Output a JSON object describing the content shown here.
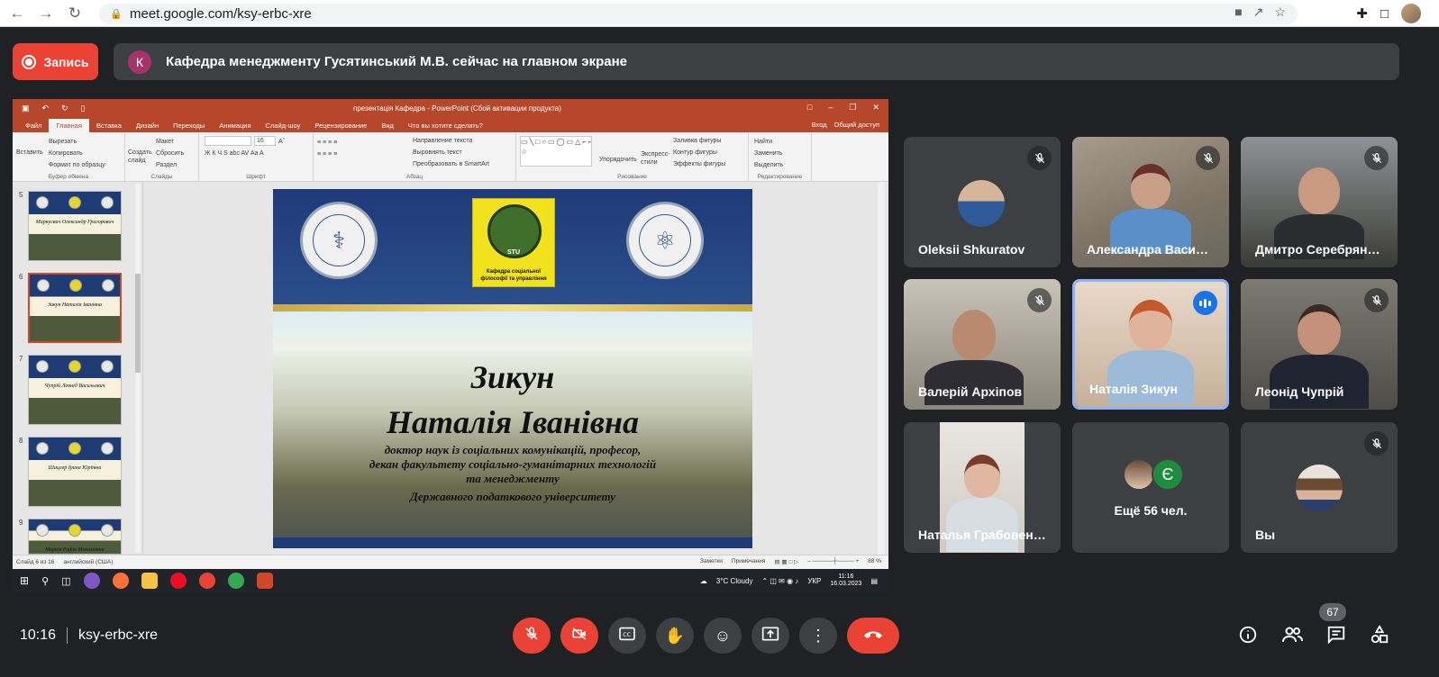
{
  "browser": {
    "url": "meet.google.com/ksy-erbc-xre"
  },
  "meet": {
    "record_label": "Запись",
    "presenter_initial": "К",
    "presenting_text": "Кафедра менеджменту Гусятинський М.В. сейчас на главном экране",
    "time": "10:16",
    "meeting_code": "ksy-erbc-xre",
    "participant_count": "67"
  },
  "powerpoint": {
    "doc_title": "презентація Кафедра - PowerPoint (Сбой активации продукта)",
    "tabs": [
      "Файл",
      "Главная",
      "Вставка",
      "Дизайн",
      "Переходы",
      "Анимация",
      "Слайд-шоу",
      "Рецензирование",
      "Вид",
      "Что вы хотите сделать?"
    ],
    "tabs_right": [
      "Вход",
      "Общий доступ"
    ],
    "ribbon": {
      "insert": "Вставить",
      "cut": "Вырезать",
      "copy": "Копировать",
      "format_painter": "Формат по образцу",
      "clipboard": "Буфер обмена",
      "new_slide": "Создать слайд",
      "layout": "Макет",
      "reset": "Сбросить",
      "section": "Раздел",
      "slides": "Слайды",
      "font_size": "16",
      "font_group": "Шрифт",
      "text_direction": "Направление текста",
      "align_text": "Выровнять текст",
      "smartart": "Преобразовать в SmartArt",
      "paragraph": "Абзац",
      "arrange": "Упорядочить",
      "quick_styles": "Экспресс-стили",
      "shape_fill": "Заливка фигуры",
      "shape_outline": "Контур фигуры",
      "shape_effects": "Эффекты фигуры",
      "drawing": "Рисование",
      "find": "Найти",
      "replace": "Заменить",
      "select": "Выделить",
      "editing": "Редактирование"
    },
    "thumbnails": [
      {
        "num": "5",
        "name": "Маркусвич Олександр Григорович"
      },
      {
        "num": "6",
        "name": "Зикун Наталія Іванівна"
      },
      {
        "num": "7",
        "name": "Чупрій Леонід Васильович"
      },
      {
        "num": "8",
        "name": "Шацлер Ірина Юріївна"
      },
      {
        "num": "9",
        "name": "Марків Рафія Миколаївна"
      }
    ],
    "slide": {
      "logo_caption": "Кафедра соціальної філософії та управління",
      "logo_mid": "STU",
      "surname": "Зикун",
      "fullname": "Наталія Іванівна",
      "desc1": "доктор наук із соціальних комунікацій, професор,",
      "desc2": "декан факультету соціально-гуманітарних технологій",
      "desc3": "та менеджменту",
      "desc4": "Державного податкового університету"
    },
    "status": {
      "slide_info": "Слайд 6 из 16",
      "language": "английский (США)",
      "notes": "Заметки",
      "comments": "Примечания",
      "zoom": "88 %"
    },
    "taskbar": {
      "weather": "3°C Cloudy",
      "lang": "УКР",
      "time": "11:16",
      "date": "16.03.2023"
    }
  },
  "participants": [
    {
      "name": "Oleksii Shkuratov",
      "muted": true
    },
    {
      "name": "Александра Васи…",
      "muted": true
    },
    {
      "name": "Дмитро Серебрян…",
      "muted": true
    },
    {
      "name": "Валерій Архіпов",
      "muted": true
    },
    {
      "name": "Наталія Зикун",
      "speaking": true
    },
    {
      "name": "Леонід Чупрій",
      "muted": true
    },
    {
      "name": "Наталья Грабовен…",
      "muted": false
    },
    {
      "name": "Ещё 56 чел.",
      "initial": "Є"
    },
    {
      "name": "Вы",
      "muted": true
    }
  ],
  "colors": {
    "meet_bg": "#202124",
    "tile_bg": "#3c4043",
    "red": "#ea4335",
    "blue": "#1a73e8",
    "ppt_red": "#b7472a"
  }
}
